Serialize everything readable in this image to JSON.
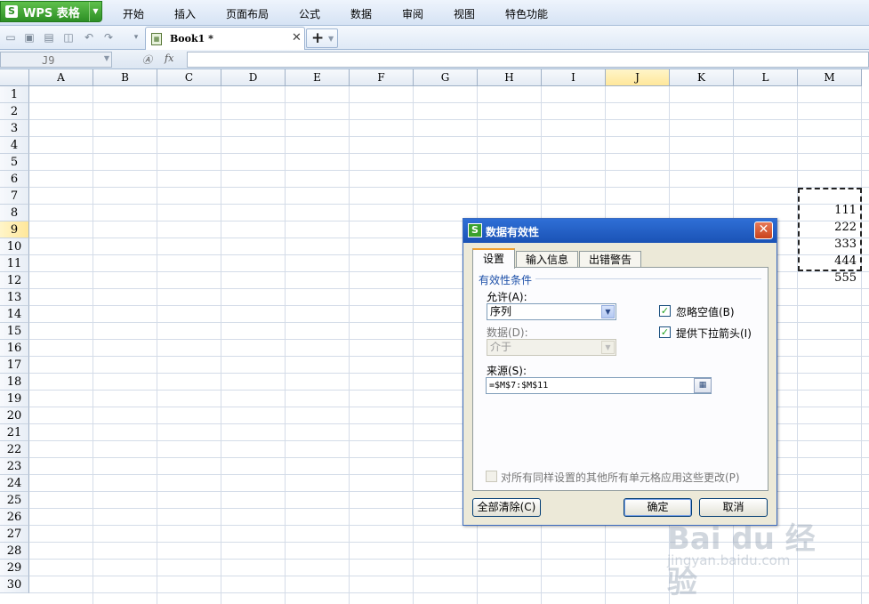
{
  "app": {
    "brand": "WPS 表格",
    "logo_glyph": "S",
    "brand_color": "#3a9d2e"
  },
  "menu": [
    {
      "label": "开始"
    },
    {
      "label": "插入"
    },
    {
      "label": "页面布局"
    },
    {
      "label": "公式"
    },
    {
      "label": "数据"
    },
    {
      "label": "审阅"
    },
    {
      "label": "视图"
    },
    {
      "label": "特色功能"
    }
  ],
  "toolbar_icons": [
    "open-icon",
    "save-icon",
    "print-icon",
    "print-preview-icon",
    "undo-icon",
    "redo-icon",
    "customize-icon"
  ],
  "tab": {
    "name": "Book1 *"
  },
  "formula_bar": {
    "name_box": "J9",
    "fx": "fx",
    "formula": ""
  },
  "grid": {
    "columns": [
      "A",
      "B",
      "C",
      "D",
      "E",
      "F",
      "G",
      "H",
      "I",
      "J",
      "K",
      "L",
      "M"
    ],
    "rows": [
      "1",
      "2",
      "3",
      "4",
      "5",
      "6",
      "7",
      "8",
      "9",
      "10",
      "11",
      "12",
      "13",
      "14",
      "15",
      "16",
      "17",
      "18",
      "19",
      "20",
      "21",
      "22",
      "23",
      "24",
      "25",
      "26",
      "27",
      "28",
      "29",
      "30"
    ],
    "active_column": "J",
    "active_row": "9",
    "m_values": [
      {
        "row": "7",
        "value": "111"
      },
      {
        "row": "8",
        "value": "222"
      },
      {
        "row": "9",
        "value": "333"
      },
      {
        "row": "10",
        "value": "444"
      },
      {
        "row": "11",
        "value": "555"
      }
    ]
  },
  "dialog": {
    "title": "数据有效性",
    "tabs": [
      {
        "label": "设置",
        "active": true
      },
      {
        "label": "输入信息",
        "active": false
      },
      {
        "label": "出错警告",
        "active": false
      }
    ],
    "group_title": "有效性条件",
    "allow_label": "允许(A):",
    "allow_value": "序列",
    "data_label": "数据(D):",
    "data_value": "介于",
    "ignore_blank_label": "忽略空值(B)",
    "ignore_blank_checked": true,
    "dropdown_label": "提供下拉箭头(I)",
    "dropdown_checked": true,
    "source_label": "来源(S):",
    "source_value": "=$M$7:$M$11",
    "apply_all_label": "对所有同样设置的其他所有单元格应用这些更改(P)",
    "apply_all_checked": false,
    "clear_all": "全部清除(C)",
    "ok": "确定",
    "cancel": "取消"
  },
  "watermark": {
    "logo": "Bai du 经验",
    "url": "jingyan.baidu.com"
  }
}
